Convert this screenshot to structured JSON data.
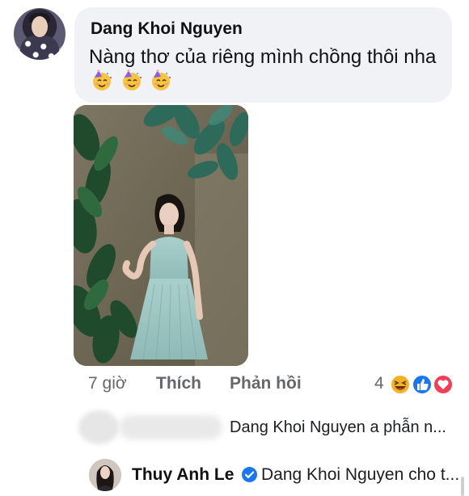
{
  "comment": {
    "author": "Dang Khoi Nguyen",
    "text": "Nàng thơ của riêng mình chồng thôi nha",
    "emojis": [
      "partying-face-icon",
      "partying-face-icon",
      "partying-face-icon"
    ]
  },
  "actions": {
    "time": "7 giờ",
    "like_label": "Thích",
    "reply_label": "Phản hồi",
    "reaction_count": "4",
    "reactions": [
      "haha-icon",
      "like-icon",
      "love-icon"
    ]
  },
  "replies": [
    {
      "author": "",
      "text": "Dang Khoi Nguyen a phẫn n..."
    },
    {
      "author": "Thuy Anh Le",
      "verified": true,
      "text": "Dang Khoi Nguyen cho t..."
    }
  ],
  "colors": {
    "bubble": "#f0f2f5",
    "meta_text": "#65676b",
    "like_blue": "#1877f2",
    "love_red": "#f33e58",
    "haha_yellow": "#f7b125"
  }
}
